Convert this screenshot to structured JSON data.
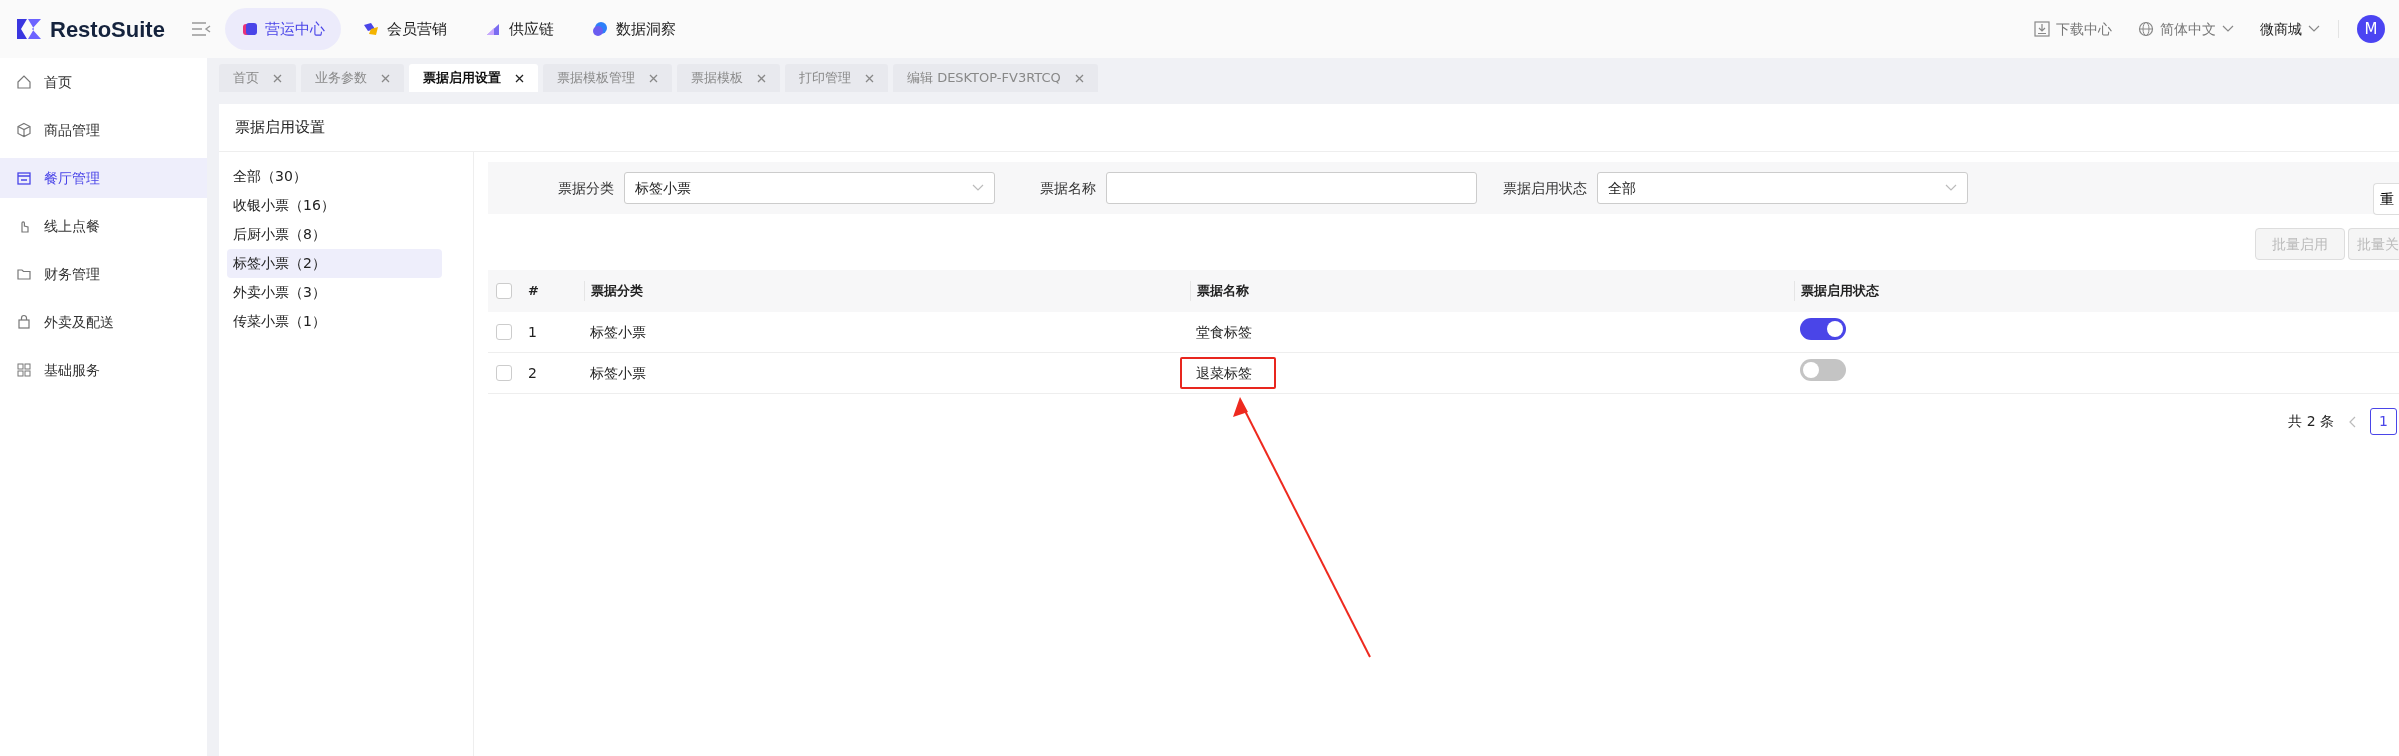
{
  "brand": {
    "name": "RestoSuite"
  },
  "modules": [
    {
      "label": "营运中心",
      "selected": true
    },
    {
      "label": "会员营销",
      "selected": false
    },
    {
      "label": "供应链",
      "selected": false
    },
    {
      "label": "数据洞察",
      "selected": false
    }
  ],
  "header_actions": {
    "download": "下载中心",
    "language": "简体中文",
    "store": "微商城",
    "avatar": "M"
  },
  "sidebar": {
    "items": [
      {
        "label": "首页",
        "selected": false
      },
      {
        "label": "商品管理",
        "selected": false
      },
      {
        "label": "餐厅管理",
        "selected": true
      },
      {
        "label": "线上点餐",
        "selected": false
      },
      {
        "label": "财务管理",
        "selected": false
      },
      {
        "label": "外卖及配送",
        "selected": false
      },
      {
        "label": "基础服务",
        "selected": false
      }
    ]
  },
  "tabs": [
    {
      "label": "首页",
      "selected": false
    },
    {
      "label": "业务参数",
      "selected": false
    },
    {
      "label": "票据启用设置",
      "selected": true
    },
    {
      "label": "票据模板管理",
      "selected": false
    },
    {
      "label": "票据模板",
      "selected": false
    },
    {
      "label": "打印管理",
      "selected": false
    },
    {
      "label": "编辑 DESKTOP-FV3RTCQ",
      "selected": false
    }
  ],
  "page_title": "票据启用设置",
  "categories": [
    {
      "label": "全部（30）",
      "selected": false
    },
    {
      "label": "收银小票（16）",
      "selected": false
    },
    {
      "label": "后厨小票（8）",
      "selected": false
    },
    {
      "label": "标签小票（2）",
      "selected": true
    },
    {
      "label": "外卖小票（3）",
      "selected": false
    },
    {
      "label": "传菜小票（1）",
      "selected": false
    }
  ],
  "filters": [
    {
      "label": "票据分类",
      "kind": "select",
      "value": "标签小票"
    },
    {
      "label": "票据名称",
      "kind": "input"
    },
    {
      "label": "票据启用状态",
      "kind": "select",
      "value": "全部"
    }
  ],
  "reset_button": "重",
  "batch_buttons": [
    {
      "label": "批量启用",
      "disabled": true
    },
    {
      "label": "批量关",
      "disabled": true
    }
  ],
  "table": {
    "all_checked": false,
    "columns": [
      "#",
      "票据分类",
      "票据名称",
      "票据启用状态"
    ],
    "rows": [
      {
        "checked": false,
        "index": "1",
        "category": "标签小票",
        "name": "堂食标签",
        "on": true,
        "highlighted": false
      },
      {
        "checked": false,
        "index": "2",
        "category": "标签小票",
        "name": "退菜标签",
        "on": false,
        "highlighted": true
      }
    ]
  },
  "pagination": {
    "total": "共 2 条",
    "current_page": "1"
  }
}
